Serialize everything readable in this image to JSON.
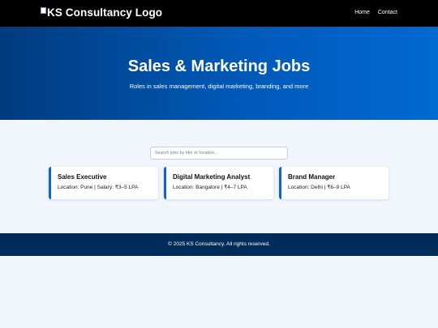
{
  "header": {
    "logo_alt": "KS Consultancy Logo",
    "nav": [
      {
        "label": "Home"
      },
      {
        "label": "Contact"
      }
    ]
  },
  "hero": {
    "title": "Sales & Marketing Jobs",
    "subtitle": "Roles in sales management, digital marketing, branding, and more"
  },
  "search": {
    "placeholder": "Search jobs by title or location...",
    "value": ""
  },
  "jobs": [
    {
      "title": "Sales Executive",
      "detail": "Location: Pune | Salary: ₹3–5 LPA"
    },
    {
      "title": "Digital Marketing Analyst",
      "detail": "Location: Bangalore | ₹4–7 LPA"
    },
    {
      "title": "Brand Manager",
      "detail": "Location: Delhi | ₹6–9 LPA"
    }
  ],
  "footer": {
    "text": "© 2025 KS Consultancy. All rights reserved."
  },
  "colors": {
    "topbar": "#000000",
    "hero_start": "#003b7e",
    "hero_end": "#0069d2",
    "page_bg": "#f1f5fc",
    "card_accent": "#0a66c2",
    "footer": "#002c5a"
  }
}
